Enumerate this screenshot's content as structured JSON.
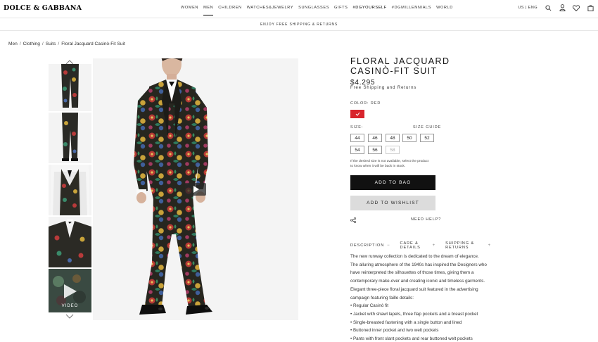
{
  "header": {
    "logo": "DOLCE & GABBANA",
    "nav": [
      "WOMEN",
      "MEN",
      "CHILDREN",
      "WATCHES&JEWELRY",
      "SUNGLASSES",
      "GIFTS",
      "#DGYOURSELF",
      "#DGMILLENNIALS",
      "WORLD"
    ],
    "active_nav": "MEN",
    "lang": "US | ENG",
    "icons": [
      "search-icon",
      "account-icon",
      "wishlist-icon",
      "bag-icon"
    ]
  },
  "promo": "ENJOY FREE SHIPPING & RETURNS",
  "breadcrumb": [
    "Men",
    "Clothing",
    "Suits",
    "Floral Jacquard Casinò-Fit Suit"
  ],
  "gallery": {
    "video_label": "VIDEO"
  },
  "product": {
    "title": "FLORAL JACQUARD CASINÒ-FIT SUIT",
    "price": "$4.295",
    "shipping": "Free Shipping and Returns",
    "color_label": "COLOR: RED",
    "swatch_color": "#d8242c",
    "size_label": "SIZE:",
    "size_guide": "SIZE GUIDE",
    "sizes": [
      {
        "label": "44",
        "available": true
      },
      {
        "label": "46",
        "available": true
      },
      {
        "label": "48",
        "available": true
      },
      {
        "label": "50",
        "available": true
      },
      {
        "label": "52",
        "available": true
      },
      {
        "label": "54",
        "available": true
      },
      {
        "label": "56",
        "available": true
      },
      {
        "label": "58",
        "available": false
      }
    ],
    "availability_note": "If the desired size is not available, select the product to know when it will be back in stock.",
    "add_to_bag": "ADD TO BAG",
    "add_to_wishlist": "ADD TO WISHLIST",
    "need_help": "NEED HELP?"
  },
  "tabs": [
    {
      "label": "DESCRIPTION",
      "symbol": "−"
    },
    {
      "label": "CARE & DETAILS",
      "symbol": "+"
    },
    {
      "label": "SHIPPING & RETURNS",
      "symbol": "+"
    }
  ],
  "description": [
    "The new runway collection is dedicated to the dream of elegance.",
    "The alluring atmosphere of the 1940s has inspired the Designers who",
    "have reinterpreted the silhouettes of those times, giving them a",
    "contemporary make-over and creating iconic and timeless garments.",
    "Elegant three-piece floral jacquard suit featured in the advertising",
    "campaign featuring faille details:",
    "• Regular Casinò fit",
    "• Jacket with shawl lapels, three flap pockets and a breast pocket",
    "• Single-breasted fastening with a single button and lined",
    "• Buttoned inner pocket and two welt pockets",
    "• Pants with front slant pockets and rear buttoned welt pockets"
  ]
}
